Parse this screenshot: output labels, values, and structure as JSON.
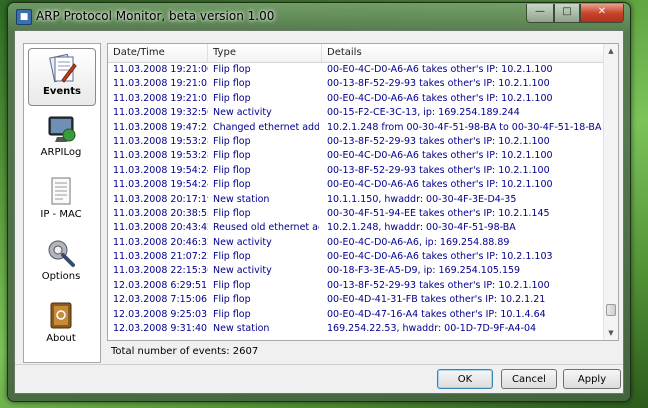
{
  "window": {
    "title": "ARP Protocol Monitor, beta version 1.00"
  },
  "sidebar": {
    "items": [
      {
        "label": "Events",
        "icon": "events-icon",
        "selected": true
      },
      {
        "label": "ARPILog",
        "icon": "monitor-icon",
        "selected": false
      },
      {
        "label": "IP - MAC",
        "icon": "list-icon",
        "selected": false
      },
      {
        "label": "Options",
        "icon": "options-icon",
        "selected": false
      },
      {
        "label": "About",
        "icon": "book-icon",
        "selected": false
      }
    ]
  },
  "table": {
    "columns": [
      "Date/Time",
      "Type",
      "Details"
    ],
    "rows": [
      [
        "11.03.2008 19:21:00",
        "Flip flop",
        "00-E0-4C-D0-A6-A6 takes other's IP: 10.2.1.100"
      ],
      [
        "11.03.2008 19:21:03",
        "Flip flop",
        "00-13-8F-52-29-93 takes other's IP: 10.2.1.100"
      ],
      [
        "11.03.2008 19:21:03",
        "Flip flop",
        "00-E0-4C-D0-A6-A6 takes other's IP: 10.2.1.100"
      ],
      [
        "11.03.2008 19:32:50",
        "New activity",
        "00-15-F2-CE-3C-13, ip: 169.254.189.244"
      ],
      [
        "11.03.2008 19:47:25",
        "Changed ethernet addr...",
        "10.2.1.248 from 00-30-4F-51-98-BA to 00-30-4F-51-18-BA"
      ],
      [
        "11.03.2008 19:53:28",
        "Flip flop",
        "00-13-8F-52-29-93 takes other's IP: 10.2.1.100"
      ],
      [
        "11.03.2008 19:53:28",
        "Flip flop",
        "00-E0-4C-D0-A6-A6 takes other's IP: 10.2.1.100"
      ],
      [
        "11.03.2008 19:54:24",
        "Flip flop",
        "00-13-8F-52-29-93 takes other's IP: 10.2.1.100"
      ],
      [
        "11.03.2008 19:54:24",
        "Flip flop",
        "00-E0-4C-D0-A6-A6 takes other's IP: 10.2.1.100"
      ],
      [
        "11.03.2008 20:17:19",
        "New station",
        "10.1.1.150, hwaddr: 00-30-4F-3E-D4-35"
      ],
      [
        "11.03.2008 20:38:55",
        "Flip flop",
        "00-30-4F-51-94-EE takes other's IP: 10.2.1.145"
      ],
      [
        "11.03.2008 20:43:42",
        "Reused old ethernet ad...",
        "10.2.1.248, hwaddr: 00-30-4F-51-98-BA"
      ],
      [
        "11.03.2008 20:46:32",
        "New activity",
        "00-E0-4C-D0-A6-A6, ip: 169.254.88.89"
      ],
      [
        "11.03.2008 21:07:22",
        "Flip flop",
        "00-E0-4C-D0-A6-A6 takes other's IP: 10.2.1.103"
      ],
      [
        "11.03.2008 22:15:36",
        "New activity",
        "00-18-F3-3E-A5-D9, ip: 169.254.105.159"
      ],
      [
        "12.03.2008 6:29:51",
        "Flip flop",
        "00-13-8F-52-29-93 takes other's IP: 10.2.1.100"
      ],
      [
        "12.03.2008 7:15:06",
        "Flip flop",
        "00-E0-4D-41-31-FB takes other's IP: 10.2.1.21"
      ],
      [
        "12.03.2008 9:25:03",
        "Flip flop",
        "00-E0-4D-47-16-A4 takes other's IP: 10.1.4.64"
      ],
      [
        "12.03.2008 9:31:40",
        "New station",
        "169.254.22.53, hwaddr: 00-1D-7D-9F-A4-04"
      ]
    ]
  },
  "status": {
    "total": "Total number of events: 2607"
  },
  "buttons": {
    "ok": "OK",
    "cancel": "Cancel",
    "apply": "Apply"
  }
}
